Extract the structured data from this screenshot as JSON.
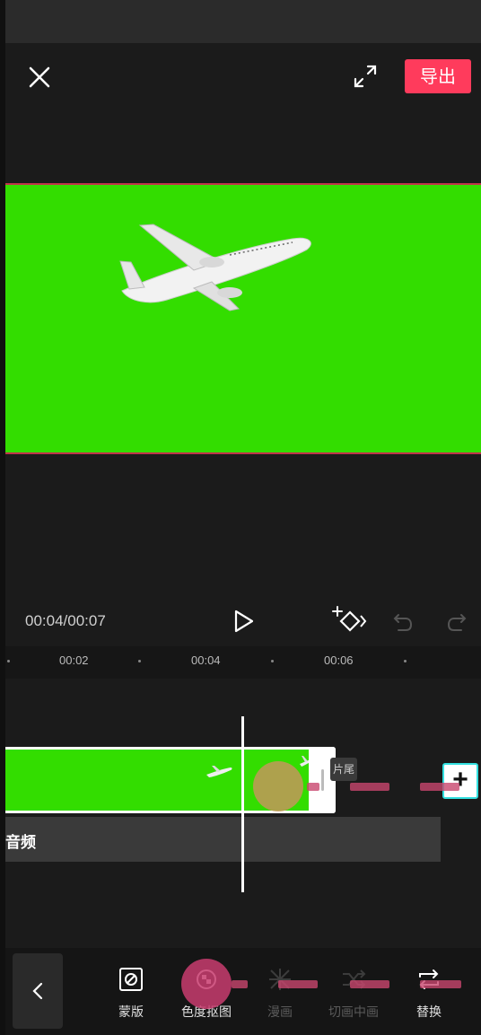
{
  "header": {
    "export_label": "导出"
  },
  "playback": {
    "timecode": "00:04/00:07"
  },
  "ruler": {
    "ticks": [
      "00:02",
      "00:04",
      "00:06"
    ]
  },
  "timeline": {
    "ending_label": "片尾",
    "audio_label": "音频",
    "add_label": "+"
  },
  "toolbar": {
    "items": [
      {
        "label": "蒙版",
        "icon": "mask-icon",
        "enabled": true
      },
      {
        "label": "色度抠图",
        "icon": "chroma-key-icon",
        "enabled": true
      },
      {
        "label": "漫画",
        "icon": "comic-icon",
        "enabled": false
      },
      {
        "label": "切画中画",
        "icon": "pip-switch-icon",
        "enabled": false
      },
      {
        "label": "替换",
        "icon": "replace-icon",
        "enabled": true
      }
    ]
  },
  "colors": {
    "accent": "#ff3b5c",
    "chroma_green": "#33dd00",
    "background": "#1b1b1b"
  }
}
